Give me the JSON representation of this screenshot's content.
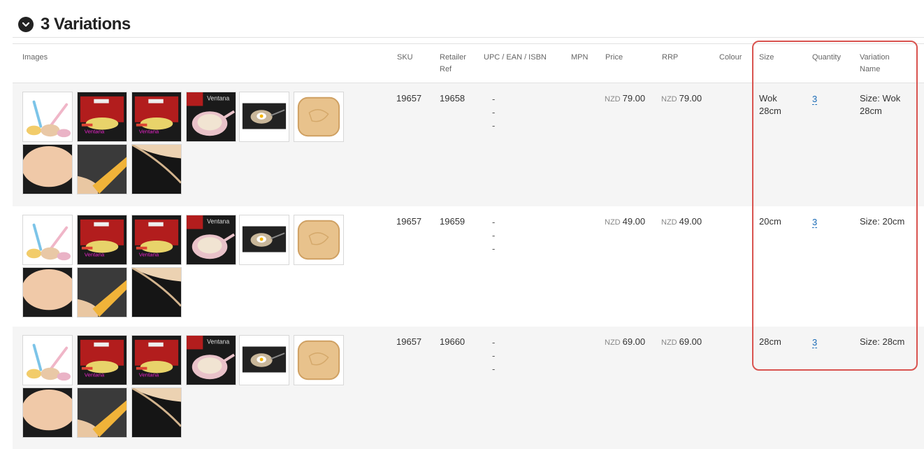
{
  "section": {
    "title": "3 Variations",
    "toggle_icon": "chevron-down-circle-icon"
  },
  "columns": {
    "images": "Images",
    "sku": "SKU",
    "retailer_ref_1": "Retailer",
    "retailer_ref_2": "Ref",
    "upc": "UPC / EAN / ISBN",
    "mpn": "MPN",
    "price": "Price",
    "rrp": "RRP",
    "colour": "Colour",
    "size": "Size",
    "quantity": "Quantity",
    "variation_name_1": "Variation",
    "variation_name_2": "Name"
  },
  "rows": [
    {
      "sku": "19657",
      "retailer_ref": "19658",
      "upc": [
        "-",
        "-",
        "-"
      ],
      "price_currency": "NZD",
      "price": "79.00",
      "rrp_currency": "NZD",
      "rrp": "79.00",
      "colour": "",
      "size_1": "Wok",
      "size_2": "28cm",
      "quantity": "3",
      "variation_name_1": "Size: Wok",
      "variation_name_2": "28cm"
    },
    {
      "sku": "19657",
      "retailer_ref": "19659",
      "upc": [
        "-",
        "-",
        "-"
      ],
      "price_currency": "NZD",
      "price": "49.00",
      "rrp_currency": "NZD",
      "rrp": "49.00",
      "colour": "",
      "size_1": "20cm",
      "size_2": "",
      "quantity": "3",
      "variation_name_1": "Size: 20cm",
      "variation_name_2": ""
    },
    {
      "sku": "19657",
      "retailer_ref": "19660",
      "upc": [
        "-",
        "-",
        "-"
      ],
      "price_currency": "NZD",
      "price": "69.00",
      "rrp_currency": "NZD",
      "rrp": "69.00",
      "colour": "",
      "size_1": "28cm",
      "size_2": "",
      "quantity": "3",
      "variation_name_1": "Size: 28cm",
      "variation_name_2": ""
    }
  ],
  "thumbnail_icons": [
    "pan-set-pastel-image",
    "ventana-box-red-image",
    "ventana-box-red-image",
    "ventana-box-pink-pan-image",
    "pan-with-egg-image",
    "pan-surface-closeup-image",
    "pan-inner-closeup-image",
    "pan-handle-closeup-image",
    "pan-rim-closeup-image"
  ],
  "colors": {
    "link": "#1a6bb6",
    "highlight": "#d9534f",
    "row_shade": "#f5f5f5"
  }
}
